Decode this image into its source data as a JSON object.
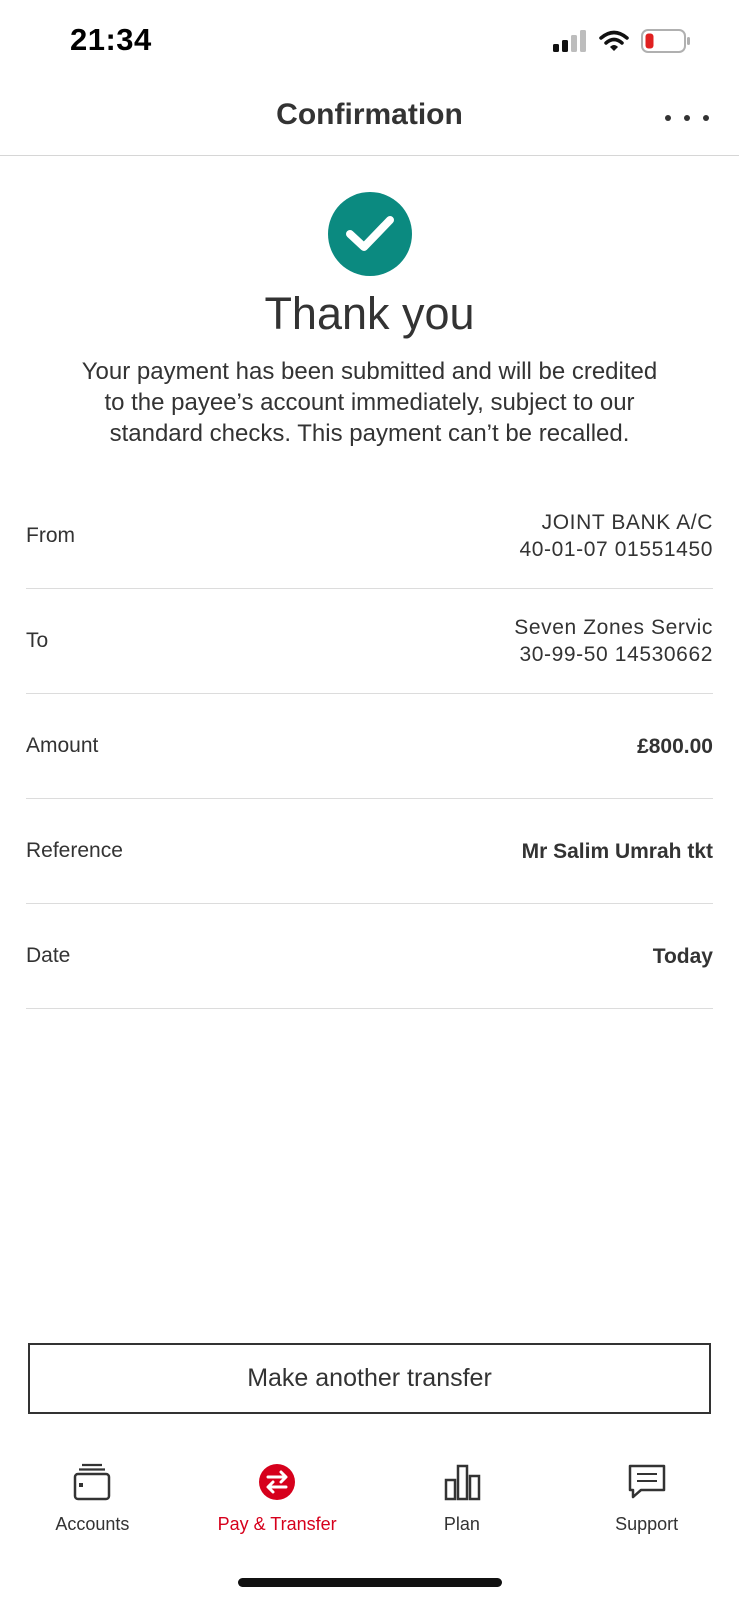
{
  "status_bar": {
    "time": "21:34",
    "icons": [
      "signal-icon",
      "wifi-icon",
      "battery-low-icon"
    ],
    "battery_color": "#e02020"
  },
  "header": {
    "title": "Confirmation",
    "menu_icon": "more-horizontal-icon"
  },
  "confirmation": {
    "icon": "check-circle-icon",
    "icon_color": "#0b8a80",
    "title": "Thank you",
    "message_line1": "Your payment has been submitted and will be credited",
    "message_line2": "to the payee’s account immediately, subject to our",
    "message_line3": "standard checks. This payment can’t be recalled."
  },
  "details": {
    "from": {
      "label": "From",
      "name": "JOINT BANK A/C",
      "account": "40-01-07 01551450"
    },
    "to": {
      "label": "To",
      "name": "Seven Zones Servic",
      "account": "30-99-50 14530662"
    },
    "amount": {
      "label": "Amount",
      "value": "£800.00"
    },
    "reference": {
      "label": "Reference",
      "value": "Mr Salim Umrah tkt"
    },
    "date": {
      "label": "Date",
      "value": "Today"
    }
  },
  "actions": {
    "another_transfer": "Make another transfer"
  },
  "tab_bar": {
    "active_color": "#d6001c",
    "tabs": [
      {
        "label": "Accounts",
        "icon": "wallet-icon"
      },
      {
        "label": "Pay & Transfer",
        "icon": "transfer-arrows-icon"
      },
      {
        "label": "Plan",
        "icon": "bar-chart-icon"
      },
      {
        "label": "Support",
        "icon": "chat-bubble-icon"
      }
    ]
  }
}
